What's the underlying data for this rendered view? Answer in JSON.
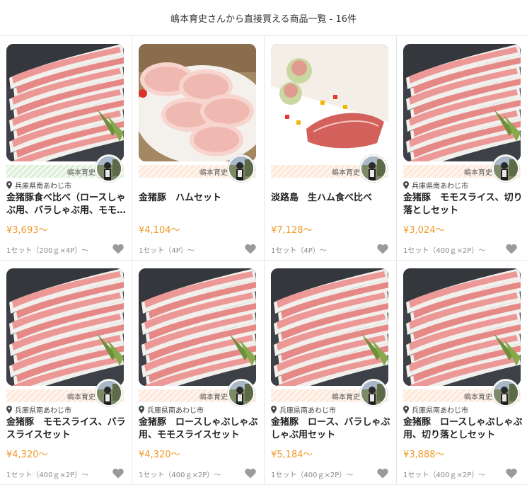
{
  "header": {
    "title": "嶋本育史さんから直接買える商品一覧 - 16件"
  },
  "colors": {
    "price": "#f09a2a",
    "heart": "#9a9a9a",
    "seller_orange": "#fde9db",
    "seller_green": "#dcefd8"
  },
  "products": [
    {
      "image": "pork-slices-dark-plate",
      "seller": "嶋本育史",
      "location": "兵庫県南あわじ市",
      "title": "金猪豚食べ比べ（ロースしゃぶ用、バラしゃぶ用、モモ…",
      "price": "¥3,693〜",
      "unit": "1セット（200ｇ×4P）〜",
      "seller_style": "green"
    },
    {
      "image": "ham-slices",
      "seller": "嶋本育史",
      "location": "",
      "title": "金猪豚　ハムセット",
      "price": "¥4,104〜",
      "unit": "1セット（4P）〜",
      "seller_style": "orange"
    },
    {
      "image": "raw-ham-plate",
      "seller": "嶋本育史",
      "location": "",
      "title": "淡路島　生ハム食べ比べ",
      "price": "¥7,128〜",
      "unit": "1セット（4P）〜",
      "seller_style": "orange"
    },
    {
      "image": "pork-slices-dark-plate",
      "seller": "嶋本育史",
      "location": "兵庫県南あわじ市",
      "title": "金猪豚　モモスライス、切り落としセット",
      "price": "¥3,024〜",
      "unit": "1セット（400ｇ×2P）〜",
      "seller_style": "orange"
    },
    {
      "image": "pork-slices-dark-plate",
      "seller": "嶋本育史",
      "location": "兵庫県南あわじ市",
      "title": "金猪豚　モモスライス、バラスライスセット",
      "price": "¥4,320〜",
      "unit": "1セット（400ｇ×2P）〜",
      "seller_style": "orange"
    },
    {
      "image": "pork-slices-dark-plate",
      "seller": "嶋本育史",
      "location": "兵庫県南あわじ市",
      "title": "金猪豚　ロースしゃぶしゃぶ用、モモスライスセット",
      "price": "¥4,320〜",
      "unit": "1セット（400ｇ×2P）〜",
      "seller_style": "orange"
    },
    {
      "image": "pork-slices-dark-plate",
      "seller": "嶋本育史",
      "location": "兵庫県南あわじ市",
      "title": "金猪豚　ロース、バラしゃぶしゃぶ用セット",
      "price": "¥5,184〜",
      "unit": "1セット（400ｇ×2P）〜",
      "seller_style": "orange"
    },
    {
      "image": "pork-slices-dark-plate",
      "seller": "嶋本育史",
      "location": "兵庫県南あわじ市",
      "title": "金猪豚　ロースしゃぶしゃぶ用、切り落としセット",
      "price": "¥3,888〜",
      "unit": "1セット（400ｇ×2P）〜",
      "seller_style": "orange"
    }
  ]
}
